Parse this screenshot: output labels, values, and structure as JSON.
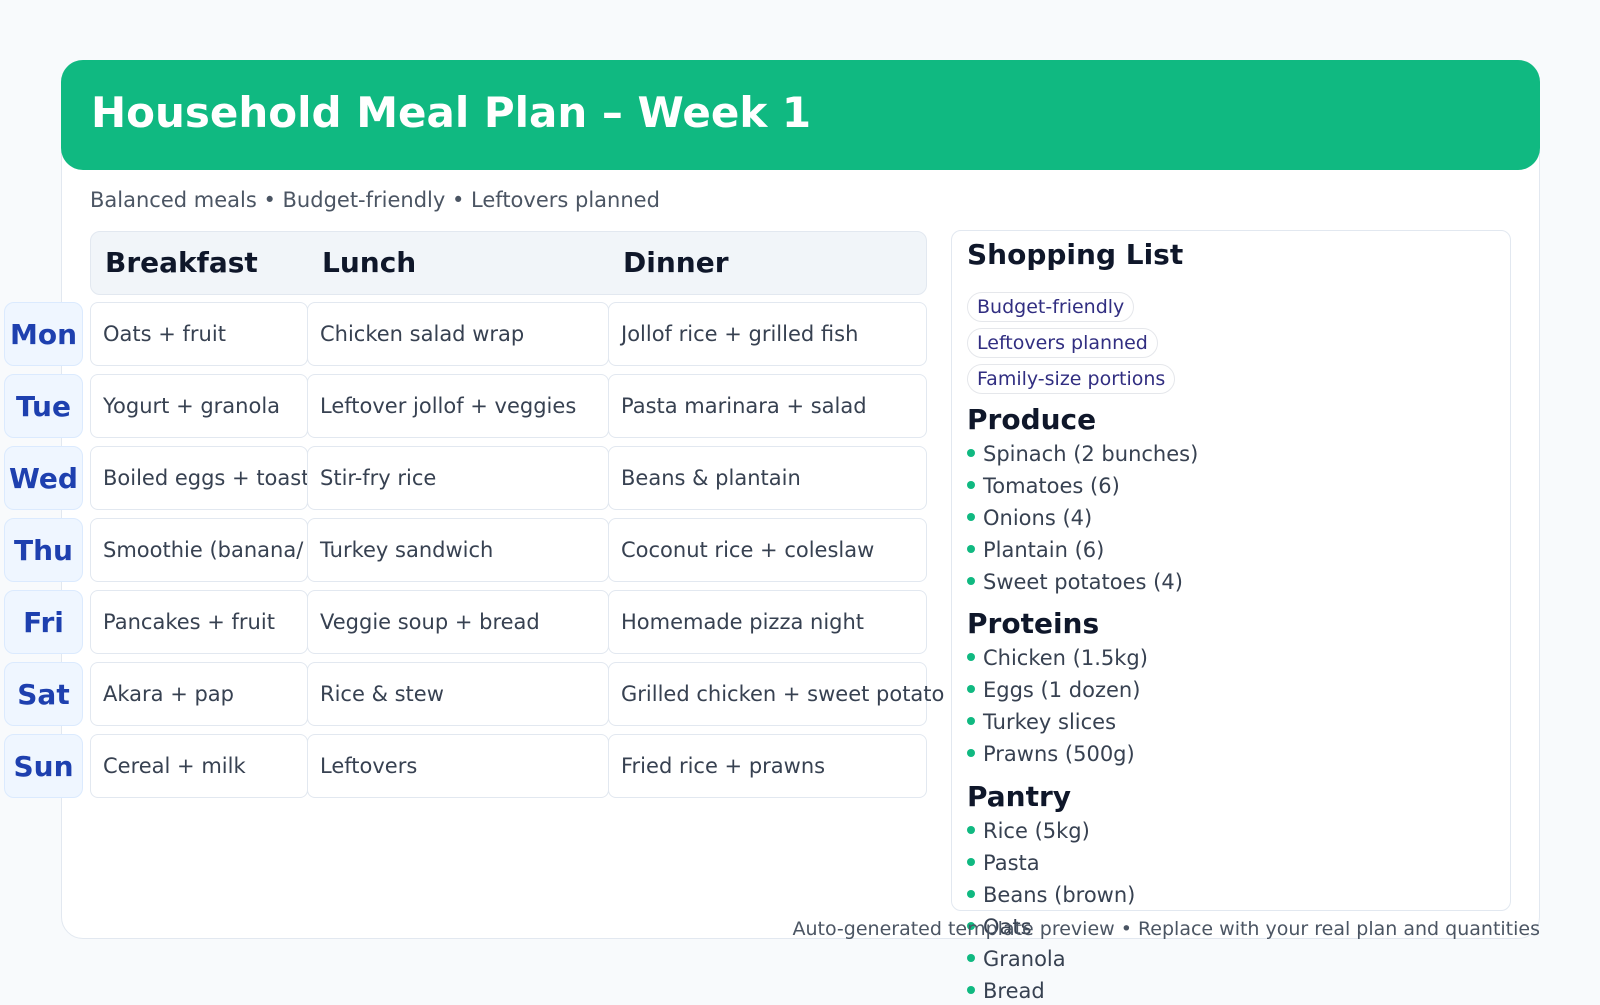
{
  "header": {
    "title": "Household Meal Plan – Week 1",
    "subtitle": "Balanced meals • Budget-friendly • Leftovers planned"
  },
  "table": {
    "columns": [
      "Breakfast",
      "Lunch",
      "Dinner"
    ],
    "rows": [
      {
        "day": "Mon",
        "breakfast": "Oats + fruit",
        "lunch": "Chicken salad wrap",
        "dinner": "Jollof rice + grilled fish"
      },
      {
        "day": "Tue",
        "breakfast": "Yogurt + granola",
        "lunch": "Leftover jollof + veggies",
        "dinner": "Pasta marinara + salad"
      },
      {
        "day": "Wed",
        "breakfast": "Boiled eggs + toast",
        "lunch": "Stir-fry rice",
        "dinner": "Beans & plantain"
      },
      {
        "day": "Thu",
        "breakfast": "Smoothie (banana/",
        "lunch": "Turkey sandwich",
        "dinner": "Coconut rice + coleslaw"
      },
      {
        "day": "Fri",
        "breakfast": "Pancakes + fruit",
        "lunch": "Veggie soup + bread",
        "dinner": "Homemade pizza night"
      },
      {
        "day": "Sat",
        "breakfast": "Akara + pap",
        "lunch": "Rice & stew",
        "dinner": "Grilled chicken + sweet potato"
      },
      {
        "day": "Sun",
        "breakfast": "Cereal + milk",
        "lunch": "Leftovers",
        "dinner": "Fried rice + prawns"
      }
    ]
  },
  "shopping": {
    "title": "Shopping List",
    "tags": [
      "Budget-friendly",
      "Leftovers planned",
      "Family-size portions"
    ],
    "sections": [
      {
        "name": "Produce",
        "items": [
          "Spinach (2 bunches)",
          "Tomatoes (6)",
          "Onions (4)",
          "Plantain (6)",
          "Sweet potatoes (4)"
        ]
      },
      {
        "name": "Proteins",
        "items": [
          "Chicken (1.5kg)",
          "Eggs (1 dozen)",
          "Turkey slices",
          "Prawns (500g)"
        ]
      },
      {
        "name": "Pantry",
        "items": [
          "Rice (5kg)",
          "Pasta",
          "Beans (brown)",
          "Oats",
          "Granola",
          "Bread"
        ]
      }
    ]
  },
  "footer": "Auto-generated template preview • Replace with your real plan and quantities",
  "colors": {
    "accent": "#10b981",
    "day_text": "#1e40af",
    "tag_text": "#312e81"
  }
}
